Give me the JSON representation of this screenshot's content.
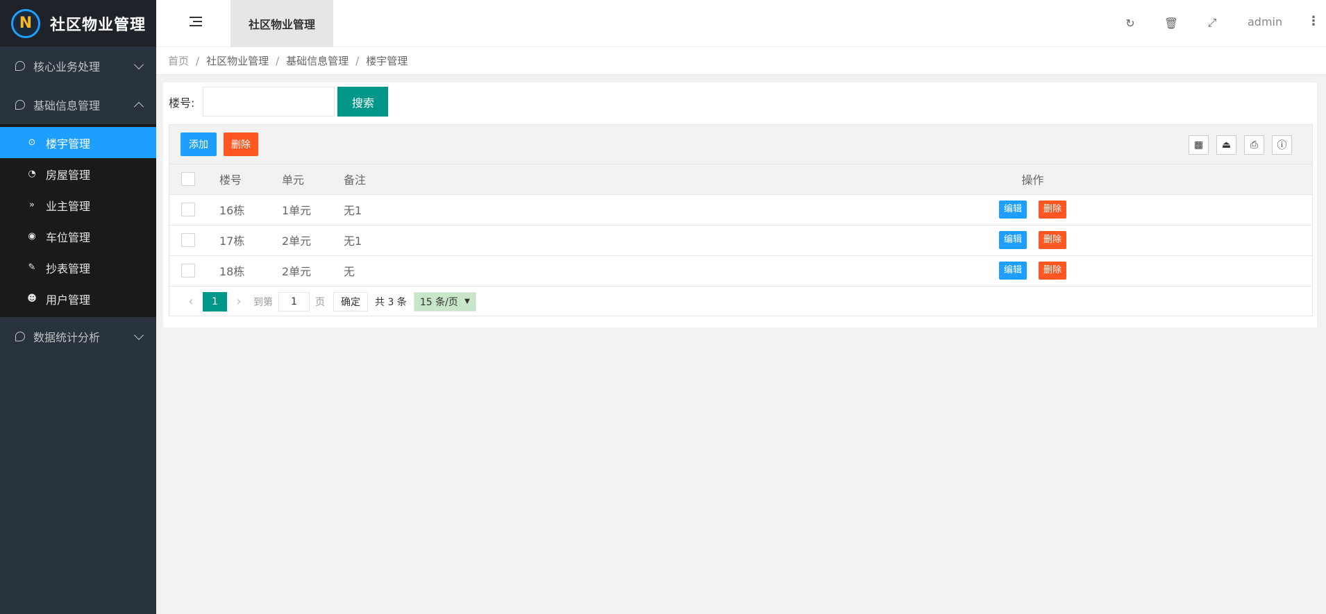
{
  "app": {
    "logo_text": "N",
    "title": "社区物业管理"
  },
  "sidebar": {
    "groups": [
      {
        "label": "核心业务处理"
      },
      {
        "label": "基础信息管理"
      },
      {
        "label": "数据统计分析"
      }
    ],
    "items": [
      {
        "label": "楼宇管理",
        "icon": "⊙"
      },
      {
        "label": "房屋管理",
        "icon": "◔"
      },
      {
        "label": "业主管理",
        "icon": "»"
      },
      {
        "label": "车位管理",
        "icon": "◉"
      },
      {
        "label": "抄表管理",
        "icon": "✎"
      },
      {
        "label": "用户管理",
        "icon": "☻"
      }
    ]
  },
  "header": {
    "tab": "社区物业管理",
    "user": "admin",
    "icons": {
      "refresh": "↻",
      "trash": "🗑",
      "fullscreen": "⤢",
      "more": "⋮"
    }
  },
  "breadcrumb": [
    "首页",
    "社区物业管理",
    "基础信息管理",
    "楼宇管理"
  ],
  "search": {
    "label": "楼号:",
    "button": "搜索"
  },
  "toolbar": {
    "add": "添加",
    "delete": "删除",
    "icons": [
      "▦",
      "⏏",
      "⎙",
      "ⓘ"
    ]
  },
  "table": {
    "headers": [
      "楼号",
      "单元",
      "备注",
      "操作"
    ],
    "rows": [
      {
        "building": "16栋",
        "unit": "1单元",
        "remark": "无1"
      },
      {
        "building": "17栋",
        "unit": "2单元",
        "remark": "无1"
      },
      {
        "building": "18栋",
        "unit": "2单元",
        "remark": "无"
      }
    ],
    "edit_label": "编辑",
    "delete_label": "删除"
  },
  "pager": {
    "prev": "‹",
    "current": "1",
    "next": "›",
    "goto_label": "到第",
    "goto_value": "1",
    "page_label": "页",
    "confirm": "确定",
    "total": "共 3 条",
    "page_size": "15 条/页"
  },
  "colors": {
    "sidebar_bg": "#28333e",
    "active": "#1e9fff",
    "primary": "#009688",
    "danger": "#ff5722"
  }
}
